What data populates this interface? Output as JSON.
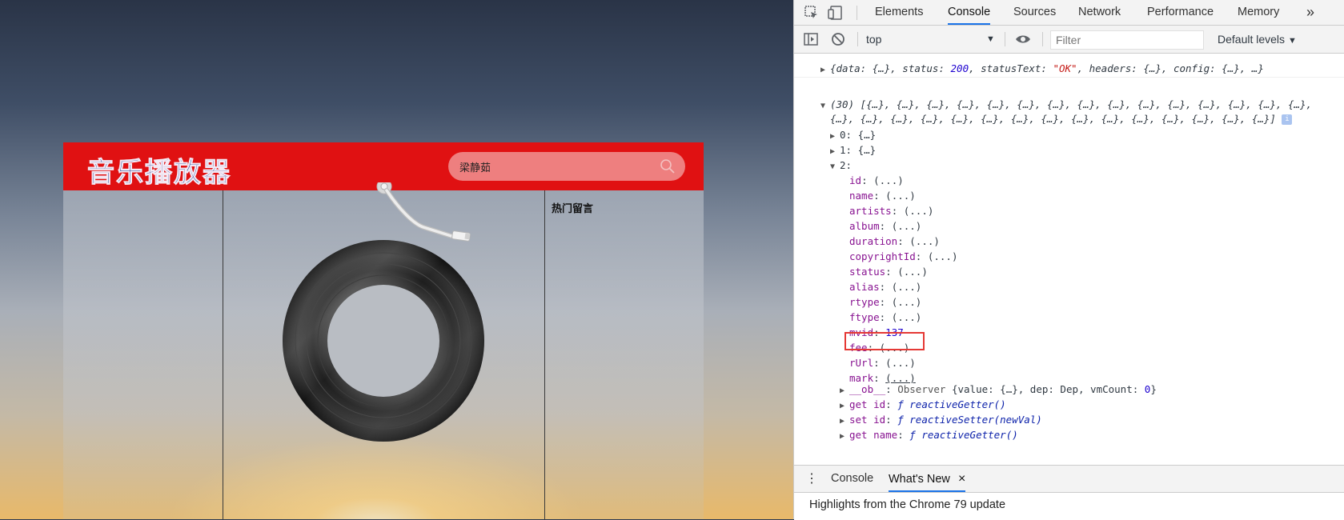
{
  "player": {
    "title": "音乐播放器",
    "search_value": "梁静茹",
    "hot_comments_label": "热门留言"
  },
  "devtools": {
    "tabs": [
      "Elements",
      "Console",
      "Sources",
      "Network",
      "Performance",
      "Memory"
    ],
    "active_tab": "Console",
    "more_tabs": "»",
    "context": "top",
    "filter_placeholder": "Filter",
    "levels": "Default levels",
    "drawer_tabs": [
      "Console",
      "What's New"
    ],
    "drawer_close": "×",
    "whats_new_text": "Highlights from the Chrome 79 update",
    "response_line": {
      "open": "{data: {…}, status: ",
      "status": "200",
      "mid": ", statusText: ",
      "status_text": "\"OK\"",
      "close": ", headers: {…}, config: {…}, …}"
    },
    "array_line_1": "(30) [{…}, {…}, {…}, {…}, {…}, {…}, {…}, {…}, {…}, {…}, {…}, {…}, {…}, {…}, {…},",
    "array_line_2": "{…}, {…}, {…}, {…}, {…}, {…}, {…}, {…}, {…}, {…}, {…}, {…}, {…}, {…}, {…}]",
    "item_0": "0: {…}",
    "item_1": "1: {…}",
    "item_2_label": "2:",
    "props": [
      {
        "key": "id",
        "value": "(...)"
      },
      {
        "key": "name",
        "value": "(...)"
      },
      {
        "key": "artists",
        "value": "(...)"
      },
      {
        "key": "album",
        "value": "(...)"
      },
      {
        "key": "duration",
        "value": "(...)"
      },
      {
        "key": "copyrightId",
        "value": "(...)"
      },
      {
        "key": "status",
        "value": "(...)"
      },
      {
        "key": "alias",
        "value": "(...)"
      },
      {
        "key": "rtype",
        "value": "(...)"
      },
      {
        "key": "ftype",
        "value": "(...)"
      },
      {
        "key": "mvid",
        "value": "137"
      },
      {
        "key": "fee",
        "value": "(...)"
      },
      {
        "key": "rUrl",
        "value": "(...)"
      },
      {
        "key": "mark",
        "value": "(...)"
      }
    ],
    "ob_line": {
      "key": "__ob__",
      "cls": "Observer",
      "body": "{value: {…}, dep: Dep, vmCount: ",
      "count": "0",
      "end": "}"
    },
    "accessors": [
      {
        "key": "get id",
        "fn": "ƒ reactiveGetter()"
      },
      {
        "key": "set id",
        "fn": "ƒ reactiveSetter(newVal)"
      },
      {
        "key": "get name",
        "fn": "ƒ reactiveGetter()"
      }
    ]
  },
  "colors": {
    "header_red": "#e01112",
    "devtools_accent": "#1a73e8",
    "highlight_red": "#e53935"
  }
}
